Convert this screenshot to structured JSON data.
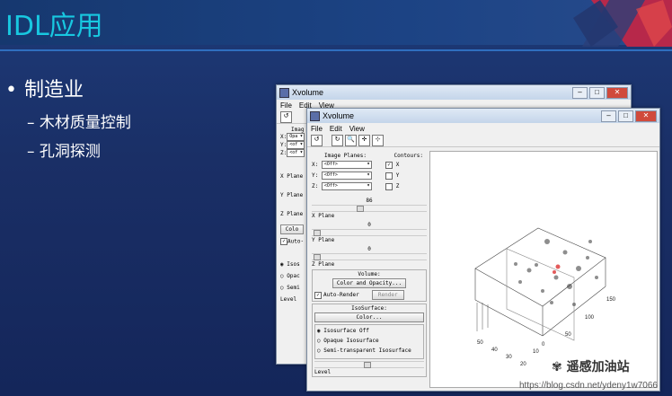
{
  "slide": {
    "title": "IDL应用",
    "bullet_main": "制造业",
    "sub_items": [
      "木材质量控制",
      "孔洞探测"
    ],
    "bullet_glyph": "•",
    "dash_glyph": "–"
  },
  "back_window": {
    "title": "Xvolume",
    "menu": [
      "File",
      "Edit",
      "View"
    ],
    "left_labels": [
      "Imag",
      "X:",
      "Y:",
      "Z:",
      "X Plane",
      "Y Plane",
      "Z Plane",
      "Colo",
      "Auto-",
      "Isos",
      "Opac",
      "Semi",
      "Level"
    ],
    "combo_values": [
      "Opa",
      "<of",
      "<of"
    ]
  },
  "front_window": {
    "title": "Xvolume",
    "menu": [
      "File",
      "Edit",
      "View"
    ],
    "image_planes_label": "Image Planes:",
    "contours_label": "Contours:",
    "plane_rows": [
      {
        "axis": "X:",
        "value": "<Off>",
        "contour": "X",
        "checked": true
      },
      {
        "axis": "Y:",
        "value": "<Off>",
        "contour": "Y",
        "checked": false
      },
      {
        "axis": "Z:",
        "value": "<Off>",
        "contour": "Z",
        "checked": false
      }
    ],
    "x_plane_value": "86",
    "x_plane_label": "X Plane",
    "y_plane_value": "0",
    "y_plane_label": "Y Plane",
    "z_plane_value": "0",
    "z_plane_label": "Z Plane",
    "volume_label": "Volume:",
    "color_opacity_button": "Color and Opacity...",
    "auto_render_label": "Auto-Render",
    "auto_render_checked": true,
    "render_button": "Render",
    "isosurface_label": "IsoSurface:",
    "color_button": "Color...",
    "iso_options": [
      "Isosurface Off",
      "Opaque Isosurface",
      "Semi-transparent Isosurface"
    ],
    "iso_selected": 0,
    "level_label": "Level",
    "axis_ticks_x": [
      "50",
      "40",
      "30",
      "20",
      "10",
      "0"
    ],
    "axis_ticks_y": [
      "50",
      "100",
      "150"
    ]
  },
  "watermark": {
    "url": "https://blog.csdn.net/ydeny1w7066",
    "wechat": "遥感加油站"
  },
  "colors": {
    "title_cyan": "#18c8e0",
    "slide_bg": "#1a2f66",
    "window_bg": "#f0f0f0",
    "close_red": "#d04a3c"
  }
}
